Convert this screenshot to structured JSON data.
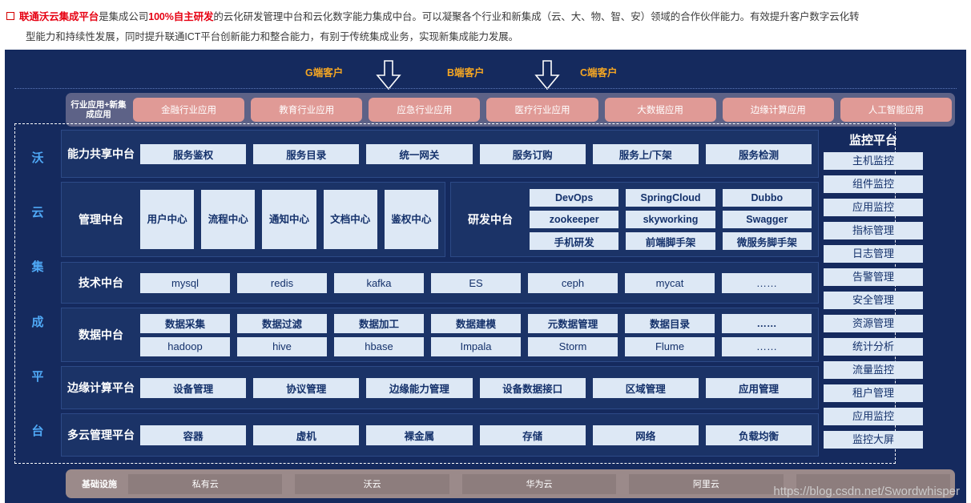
{
  "header": {
    "line1_prefix_bold": "联通沃云集成平台",
    "line1_mid1": "是集成公司",
    "line1_bold2": "100%自主研发",
    "line1_rest": "的云化研发管理中台和云化数字能力集成中台。可以凝聚各个行业和新集成（云、大、物、智、安）领域的合作伙伴能力。有效提升客户数字云化转",
    "line2": "型能力和持续性发展，同时提升联通ICT平台创新能力和整合能力，有别于传统集成业务，实现新集成能力发展。"
  },
  "clients": [
    {
      "label": "G端客户"
    },
    {
      "label": "B端客户"
    },
    {
      "label": "C端客户"
    }
  ],
  "industry": {
    "label": "行业应用+新集成应用",
    "items": [
      "金融行业应用",
      "教育行业应用",
      "应急行业应用",
      "医疗行业应用",
      "大数据应用",
      "边缘计算应用",
      "人工智能应用"
    ]
  },
  "platform_name_chars": [
    "沃",
    "云",
    "集",
    "成",
    "平",
    "台"
  ],
  "rows": {
    "capability": {
      "label": "能力共享中台",
      "items": [
        "服务鉴权",
        "服务目录",
        "统一网关",
        "服务订购",
        "服务上/下架",
        "服务检测"
      ]
    },
    "management": {
      "label": "管理中台",
      "items": [
        "用户中心",
        "流程中心",
        "通知中心",
        "文档中心",
        "鉴权中心"
      ]
    },
    "rnd": {
      "label": "研发中台",
      "items": [
        "DevOps",
        "SpringCloud",
        "Dubbo",
        "zookeeper",
        "skyworking",
        "Swagger",
        "手机研发",
        "前端脚手架",
        "微服务脚手架"
      ]
    },
    "technology": {
      "label": "技术中台",
      "items": [
        "mysql",
        "redis",
        "kafka",
        "ES",
        "ceph",
        "mycat",
        "……"
      ]
    },
    "data": {
      "label": "数据中台",
      "line1": [
        "数据采集",
        "数据过滤",
        "数据加工",
        "数据建模",
        "元数据管理",
        "数据目录",
        "……"
      ],
      "line2": [
        "hadoop",
        "hive",
        "hbase",
        "Impala",
        "Storm",
        "Flume",
        "……"
      ]
    },
    "edge": {
      "label": "边缘计算平台",
      "items": [
        "设备管理",
        "协议管理",
        "边缘能力管理",
        "设备数据接口",
        "区域管理",
        "应用管理"
      ]
    },
    "multicloud": {
      "label": "多云管理平台",
      "items": [
        "容器",
        "虚机",
        "裸金属",
        "存储",
        "网络",
        "负载均衡"
      ]
    }
  },
  "monitor": {
    "title": "监控平台",
    "items": [
      "主机监控",
      "组件监控",
      "应用监控",
      "指标管理",
      "日志管理",
      "告警管理",
      "安全管理",
      "资源管理",
      "统计分析",
      "流量监控",
      "租户管理",
      "应用监控",
      "监控大屏"
    ]
  },
  "infrastructure": {
    "label": "基础设施",
    "items": [
      "私有云",
      "沃云",
      "华为云",
      "阿里云",
      ""
    ]
  },
  "watermark": "https://blog.csdn.net/Swordwhisper",
  "colors": {
    "canvas_bg": "#152a5e",
    "row_bg": "#1b3367",
    "chip_bg": "#dde8f5",
    "chip_text": "#14316b",
    "accent_orange": "#f5a623",
    "vertical_name": "#4fa8f5",
    "industry_bar": "#5d6287",
    "industry_chip": "#e09a96",
    "infra_bar": "#9b8a8a",
    "infra_chip": "#8d7d7d",
    "red_highlight": "#e60012"
  }
}
